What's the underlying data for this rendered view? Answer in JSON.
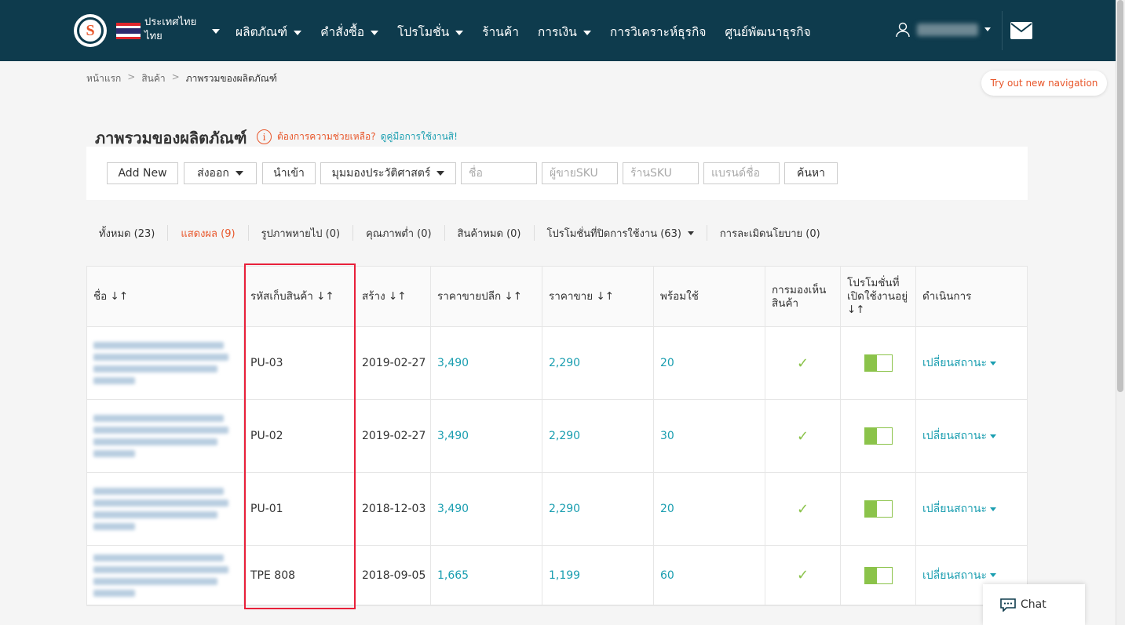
{
  "nav": {
    "country": "ประเทศไทย",
    "language": "ไทย",
    "menu": [
      "ผลิตภัณฑ์",
      "คำสั่งซื้อ",
      "โปรโมชั่น",
      "ร้านค้า",
      "การเงิน",
      "การวิเคราะห์ธุรกิจ",
      "ศูนย์พัฒนาธุรกิจ"
    ],
    "menu_has_dropdown": [
      true,
      true,
      true,
      false,
      true,
      false,
      false
    ]
  },
  "breadcrumb": [
    "หน้าแรก",
    "สินค้า",
    "ภาพรวมของผลิตภัณฑ์"
  ],
  "try_new_nav": "Try out new navigation",
  "page": {
    "title": "ภาพรวมของผลิตภัณฑ์",
    "help_question": "ต้องการความช่วยเหลือ?",
    "help_link": "ดูคู่มือการใช้งานสิ!"
  },
  "toolbar": {
    "add_new": "Add New",
    "export": "ส่งออก",
    "import": "นำเข้า",
    "history": "มุมมองประวัติศาสตร์",
    "name_placeholder": "ชื่อ",
    "seller_sku_placeholder": "ผู้ขายSKU",
    "shop_sku_placeholder": "ร้านSKU",
    "brand_placeholder": "แบรนด์ชื่อ",
    "search": "ค้นหา"
  },
  "tabs": [
    {
      "label": "ทั้งหมด (23)",
      "active": false
    },
    {
      "label": "แสดงผล (9)",
      "active": true
    },
    {
      "label": "รูปภาพหายไป (0)",
      "active": false
    },
    {
      "label": "คุณภาพต่ำ (0)",
      "active": false
    },
    {
      "label": "สินค้าหมด (0)",
      "active": false
    },
    {
      "label": "โปรโมชั่นที่ปิดการใช้งาน (63)",
      "active": false,
      "dropdown": true
    },
    {
      "label": "การละเมิดนโยบาย (0)",
      "active": false
    }
  ],
  "table": {
    "headers": {
      "name": "ชื่อ ↓↑",
      "sku": "รหัสเก็บสินค้า ↓↑",
      "created": "สร้าง ↓↑",
      "retail_price": "ราคาขายปลีก ↓↑",
      "sale_price": "ราคาขาย ↓↑",
      "available": "พร้อมใช้",
      "visibility": "การมองเห็นสินค้า",
      "promo_active": "โปรโมชั่นที่เปิดใช้งานอยู่ ↓↑",
      "actions": "ดำเนินการ"
    },
    "rows": [
      {
        "sku": "PU-03",
        "created": "2019-02-27",
        "retail": "3,490",
        "sale": "2,290",
        "available": "20",
        "visible": "✓",
        "action": "เปลี่ยนสถานะ"
      },
      {
        "sku": "PU-02",
        "created": "2019-02-27",
        "retail": "3,490",
        "sale": "2,290",
        "available": "30",
        "visible": "✓",
        "action": "เปลี่ยนสถานะ"
      },
      {
        "sku": "PU-01",
        "created": "2018-12-03",
        "retail": "3,490",
        "sale": "2,290",
        "available": "20",
        "visible": "✓",
        "action": "เปลี่ยนสถานะ"
      },
      {
        "sku": "TPE 808",
        "created": "2018-09-05",
        "retail": "1,665",
        "sale": "1,199",
        "available": "60",
        "visible": "✓",
        "action": "เปลี่ยนสถานะ"
      }
    ]
  },
  "chat": "Chat",
  "colors": {
    "nav_bg": "#0e3b4d",
    "accent": "#e8562a",
    "link": "#1a9eb0",
    "toggle": "#8bc34a",
    "highlight": "#e8203a"
  }
}
